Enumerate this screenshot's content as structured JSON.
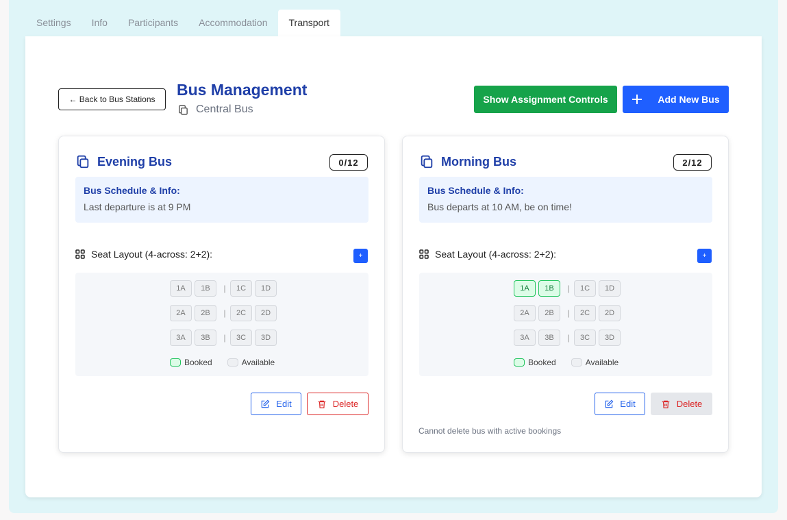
{
  "tabs": [
    {
      "label": "Settings"
    },
    {
      "label": "Info"
    },
    {
      "label": "Participants"
    },
    {
      "label": "Accommodation"
    },
    {
      "label": "Transport",
      "active": true
    }
  ],
  "header": {
    "back_label": "← Back to Bus Stations",
    "title": "Bus Management",
    "station": "Central Bus",
    "assign_label": "Show Assignment Controls",
    "add_label": "Add New Bus"
  },
  "buses": [
    {
      "name": "Evening Bus",
      "count": "0/12",
      "info_title": "Bus Schedule & Info:",
      "info_text": "Last departure is at 9 PM",
      "layout_label": "Seat Layout (4-across: 2+2):",
      "add_small": "+",
      "seats": [
        [
          "1A",
          "1B",
          "1C",
          "1D"
        ],
        [
          "2A",
          "2B",
          "2C",
          "2D"
        ],
        [
          "3A",
          "3B",
          "3C",
          "3D"
        ]
      ],
      "booked": [],
      "legend_booked": "Booked",
      "legend_available": "Available",
      "edit_label": "Edit",
      "delete_label": "Delete",
      "note": ""
    },
    {
      "name": "Morning Bus",
      "count": "2/12",
      "info_title": "Bus Schedule & Info:",
      "info_text": "Bus departs at 10 AM, be on time!",
      "layout_label": "Seat Layout (4-across: 2+2):",
      "add_small": "+",
      "seats": [
        [
          "1A",
          "1B",
          "1C",
          "1D"
        ],
        [
          "2A",
          "2B",
          "2C",
          "2D"
        ],
        [
          "3A",
          "3B",
          "3C",
          "3D"
        ]
      ],
      "booked": [
        "1A",
        "1B"
      ],
      "legend_booked": "Booked",
      "legend_available": "Available",
      "edit_label": "Edit",
      "delete_label": "Delete",
      "note": "Cannot delete bus with active bookings"
    }
  ],
  "colors": {
    "primary": "#1f5fff",
    "success": "#16a34a",
    "danger": "#dc2626",
    "heading": "#1f3fa8"
  }
}
